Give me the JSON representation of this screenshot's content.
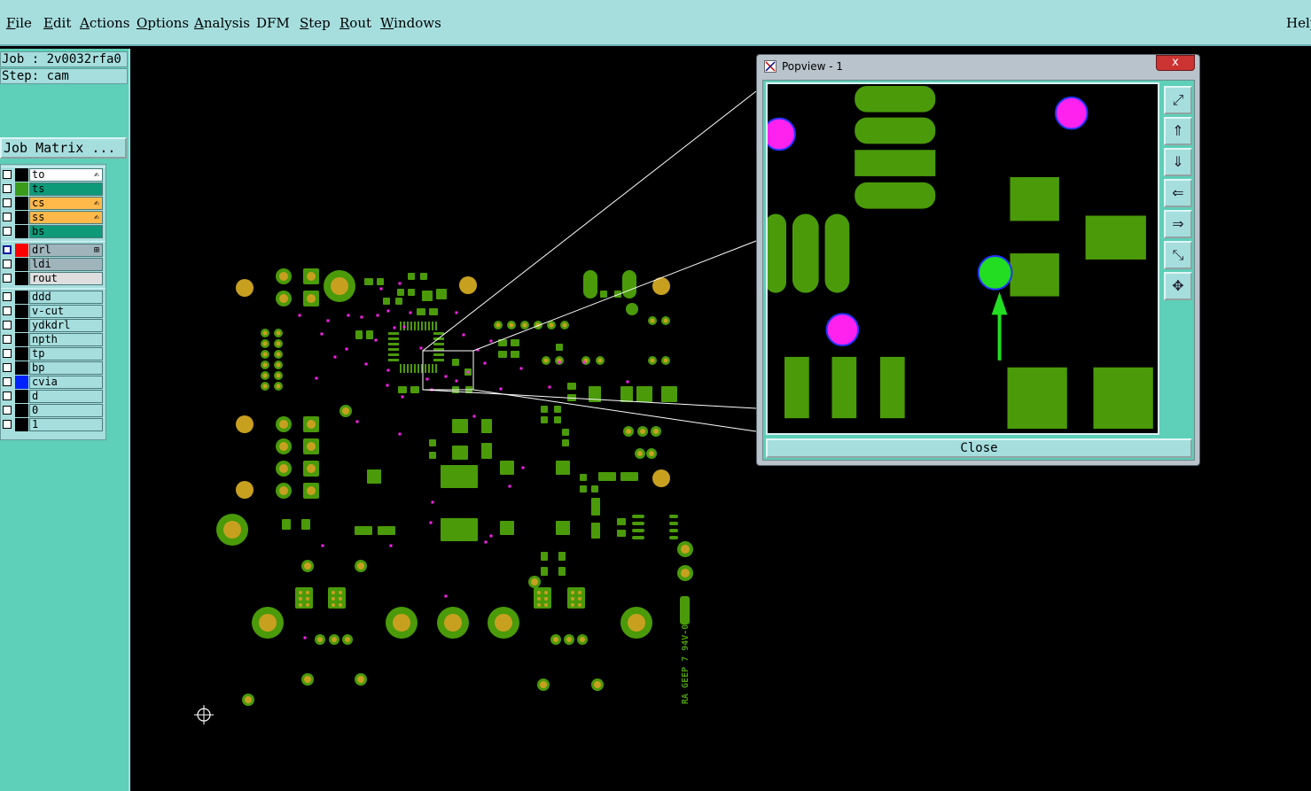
{
  "menu": {
    "file": "File",
    "edit": "Edit",
    "actions": "Actions",
    "options": "Options",
    "analysis": "Analysis",
    "dfm": "DFM",
    "step": "Step",
    "rout": "Rout",
    "windows": "Windows",
    "help": "Help"
  },
  "job": {
    "job_line": "Job : 2v0032rfa0",
    "step_line": "Step: cam",
    "matrix_button": "Job Matrix ..."
  },
  "layers": [
    {
      "name": "to",
      "swatch": "#000000",
      "label_bg": "#ffffff",
      "edit_icon": true,
      "checked": false
    },
    {
      "name": "ts",
      "swatch": "#3c9a1a",
      "label_bg": "#0e9a78",
      "edit_icon": false,
      "checked": false
    },
    {
      "name": "cs",
      "swatch": "#000000",
      "label_bg": "#ffb84a",
      "edit_icon": true,
      "checked": false
    },
    {
      "name": "ss",
      "swatch": "#000000",
      "label_bg": "#ffb84a",
      "edit_icon": true,
      "checked": false
    },
    {
      "name": "bs",
      "swatch": "#000000",
      "label_bg": "#0e9a78",
      "edit_icon": false,
      "checked": false
    },
    {
      "name": "drl",
      "swatch": "#ff0000",
      "label_bg": "#a0b4bc",
      "edit_icon": false,
      "checked": true
    },
    {
      "name": "ldi",
      "swatch": "#000000",
      "label_bg": "#a0b4bc",
      "edit_icon": false,
      "checked": false
    },
    {
      "name": "rout",
      "swatch": "#000000",
      "label_bg": "#dedede",
      "edit_icon": false,
      "checked": false
    },
    {
      "name": "ddd",
      "swatch": "#000000",
      "label_bg": "#a6dede",
      "edit_icon": false,
      "checked": false
    },
    {
      "name": "v-cut",
      "swatch": "#000000",
      "label_bg": "#a6dede",
      "edit_icon": false,
      "checked": false
    },
    {
      "name": "ydkdrl",
      "swatch": "#000000",
      "label_bg": "#a6dede",
      "edit_icon": false,
      "checked": false
    },
    {
      "name": "npth",
      "swatch": "#000000",
      "label_bg": "#a6dede",
      "edit_icon": false,
      "checked": false
    },
    {
      "name": "tp",
      "swatch": "#000000",
      "label_bg": "#a6dede",
      "edit_icon": false,
      "checked": false
    },
    {
      "name": "bp",
      "swatch": "#000000",
      "label_bg": "#a6dede",
      "edit_icon": false,
      "checked": false
    },
    {
      "name": "cvia",
      "swatch": "#0022ff",
      "label_bg": "#a6dede",
      "edit_icon": false,
      "checked": false
    },
    {
      "name": "d",
      "swatch": "#000000",
      "label_bg": "#a6dede",
      "edit_icon": false,
      "checked": false
    },
    {
      "name": "0",
      "swatch": "#000000",
      "label_bg": "#a6dede",
      "edit_icon": false,
      "checked": false
    },
    {
      "name": "1",
      "swatch": "#000000",
      "label_bg": "#a6dede",
      "edit_icon": false,
      "checked": false
    }
  ],
  "popview": {
    "title": "Popview - 1",
    "close_x": "x",
    "close_button": "Close",
    "tools": [
      "zoom-fit-icon",
      "pan-up-icon",
      "pan-down-icon",
      "pan-left-icon",
      "pan-right-icon",
      "zoom-out-icon",
      "zoom-in-icon"
    ]
  },
  "board": {
    "silkscreen_text": "RA GEEP 7 94V-0"
  },
  "colors": {
    "menubar": "#a6dede",
    "sidebar": "#5ecfb8",
    "pad_green": "#4a9a0a",
    "hole_gold": "#c8a020",
    "via_magenta": "#ff22ee",
    "highlight_green": "#22dd22"
  }
}
